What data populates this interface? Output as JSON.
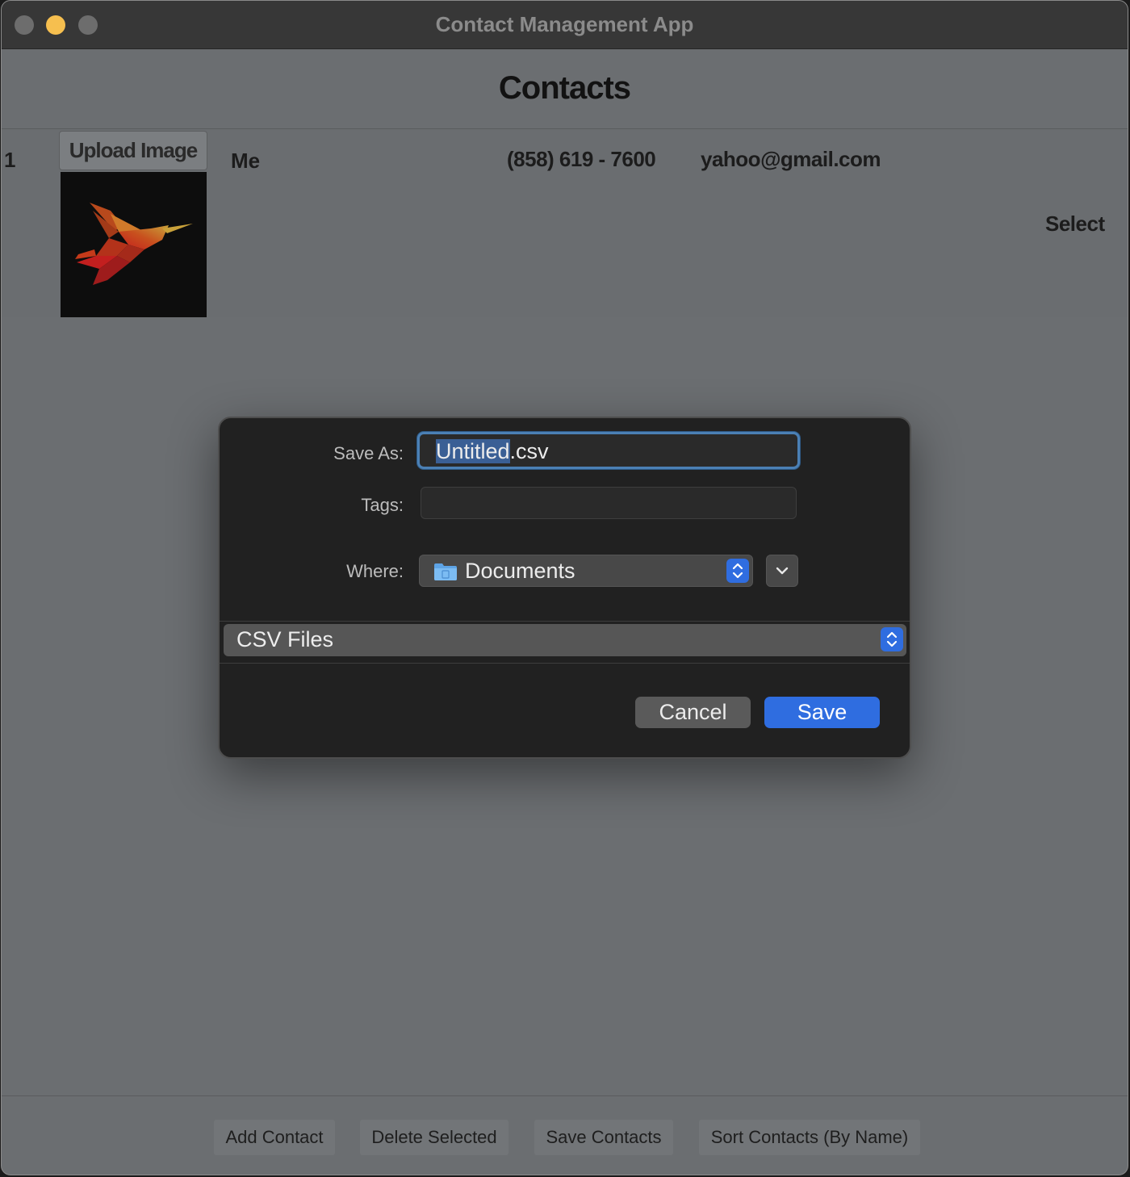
{
  "window": {
    "title": "Contact Management App"
  },
  "main": {
    "heading": "Contacts",
    "contacts": [
      {
        "index": "1",
        "upload_label": "Upload Image",
        "name": "Me",
        "phone": "(858) 619 - 7600",
        "email": "yahoo@gmail.com",
        "select_label": "Select",
        "image_icon": "hummingbird-image"
      }
    ]
  },
  "toolbar": {
    "add_label": "Add Contact",
    "delete_label": "Delete Selected",
    "save_label": "Save Contacts",
    "sort_label": "Sort Contacts (By Name)"
  },
  "save_dialog": {
    "save_as_label": "Save As:",
    "filename_base": "Untitled",
    "filename_ext": ".csv",
    "tags_label": "Tags:",
    "tags_value": "",
    "where_label": "Where:",
    "where_value": "Documents",
    "file_type": "CSV Files",
    "cancel_label": "Cancel",
    "save_label": "Save",
    "colors": {
      "accent": "#2f6de0",
      "focus_ring": "#4b80b5",
      "selection": "#3a5f95"
    }
  }
}
